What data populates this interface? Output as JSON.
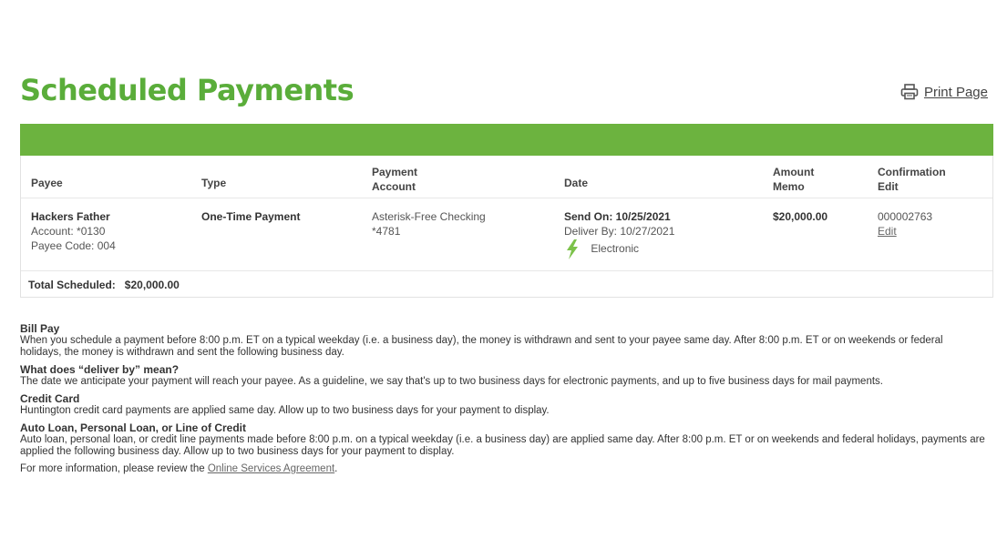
{
  "page": {
    "title": "Scheduled Payments",
    "print_label": "Print Page"
  },
  "table": {
    "headers": {
      "payee": "Payee",
      "type": "Type",
      "account_line1": "Payment",
      "account_line2": "Account",
      "date": "Date",
      "amount_line1": "Amount",
      "amount_line2": "Memo",
      "confirm_line1": "Confirmation",
      "confirm_line2": "Edit"
    },
    "row": {
      "payee_name": "Hackers Father",
      "payee_account": "Account: *0130",
      "payee_code": "Payee Code: 004",
      "type": "One-Time Payment",
      "account_name": "Asterisk-Free Checking",
      "account_number": "*4781",
      "send_on": "Send On: 10/25/2021",
      "deliver_by": "Deliver By: 10/27/2021",
      "method": "Electronic",
      "amount": "$20,000.00",
      "confirmation": "000002763",
      "edit_label": "Edit"
    },
    "total_label": "Total Scheduled:",
    "total_value": "$20,000.00"
  },
  "info": {
    "billpay_title": "Bill Pay",
    "billpay_text": "When you schedule a payment before 8:00 p.m. ET on a typical weekday (i.e. a business day), the money is withdrawn and sent to your payee same day. After 8:00 p.m. ET or on weekends or federal holidays, the money is withdrawn and sent the following business day.",
    "deliver_title": "What does “deliver by” mean?",
    "deliver_text": "The date we anticipate your payment will reach your payee. As a guideline, we say that's up to two business days for electronic payments, and up to five business days for mail payments.",
    "credit_title": "Credit Card",
    "credit_text": "Huntington credit card payments are applied same day. Allow up to two business days for your payment to display.",
    "loan_title": "Auto Loan, Personal Loan, or Line of Credit",
    "loan_text": "Auto loan, personal loan, or credit line payments made before 8:00 p.m. on a typical weekday (i.e. a business day) are applied same day. After 8:00 p.m. ET or on weekends and federal holidays, payments are applied the following business day. Allow up to two business days for your payment to display.",
    "more_prefix": "For more information, please review the ",
    "more_link": "Online Services Agreement",
    "more_suffix": "."
  },
  "colors": {
    "brand_green": "#6cb33f",
    "title_green": "#5aad3a",
    "bolt_green": "#7cc24a"
  },
  "icons": {
    "print": "printer-icon",
    "method": "lightning-bolt-icon"
  }
}
